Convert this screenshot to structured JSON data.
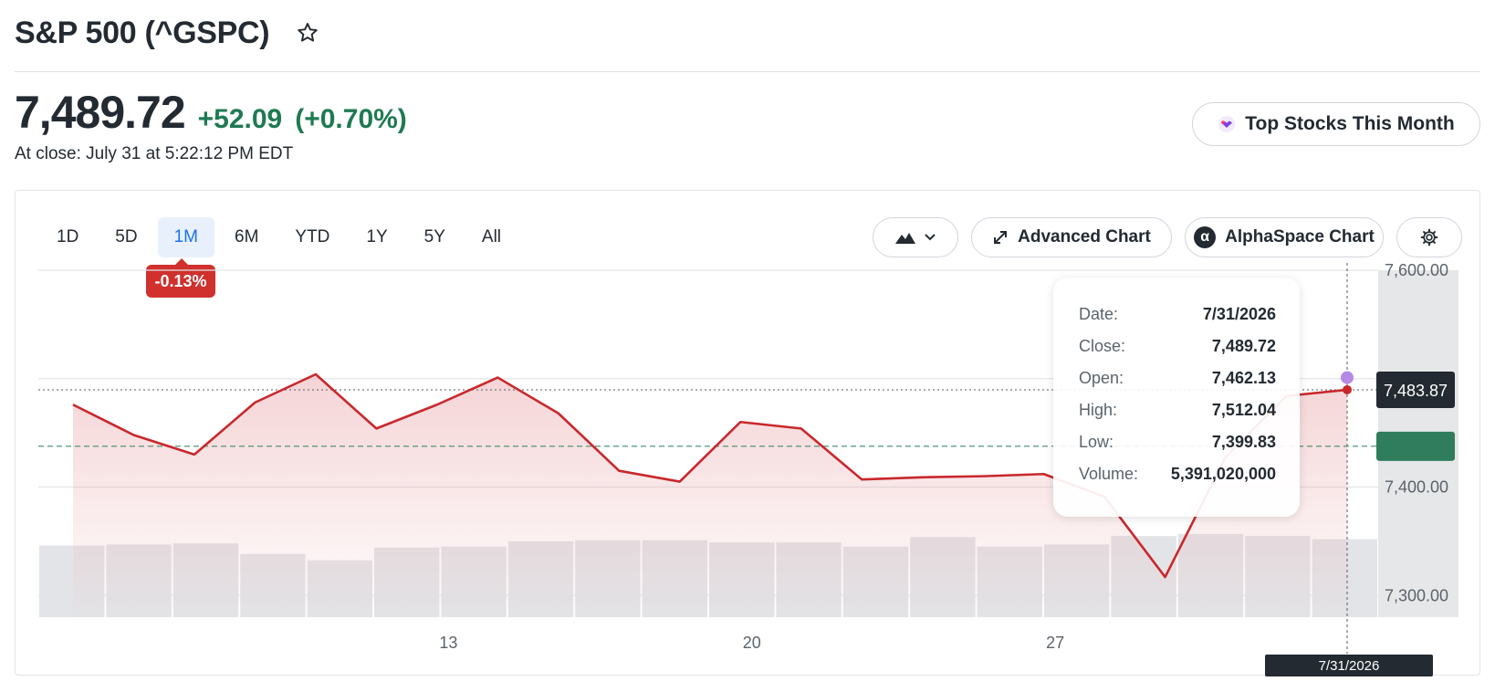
{
  "header": {
    "title": "S&P 500 (^GSPC)",
    "star_icon": "star-outline-icon"
  },
  "quote": {
    "price": "7,489.72",
    "change": "+52.09",
    "change_pct": "(+0.70%)",
    "close_time": "At close: July 31 at 5:22:12 PM EDT",
    "change_color": "#1f7a54"
  },
  "promo": {
    "label": "Top Stocks This Month",
    "icon": "sparkle-icon"
  },
  "ranges": [
    "1D",
    "5D",
    "1M",
    "6M",
    "YTD",
    "1Y",
    "5Y",
    "All"
  ],
  "active_range": "1M",
  "period_change_badge": "-0.13%",
  "toolbar": {
    "chart_type_icon": "mountain-chart-icon",
    "advanced_label": "Advanced Chart",
    "alphaspace_label": "AlphaSpace Chart",
    "alphaspace_glyph": "α",
    "settings_icon": "gear-icon"
  },
  "tooltip": [
    {
      "key": "Date:",
      "value": "7/31/2026"
    },
    {
      "key": "Close:",
      "value": "7,489.72"
    },
    {
      "key": "Open:",
      "value": "7,462.13"
    },
    {
      "key": "High:",
      "value": "7,512.04"
    },
    {
      "key": "Low:",
      "value": "7,399.83"
    },
    {
      "key": "Volume:",
      "value": "5,391,020,000"
    }
  ],
  "crosshair_date": "7/31/2026",
  "current_price_label": "7,483.87",
  "chart_data": {
    "type": "area",
    "x": [
      "7/2",
      "7/3",
      "7/6",
      "7/7",
      "7/8",
      "7/9",
      "7/10",
      "7/13",
      "7/14",
      "7/15",
      "7/16",
      "7/17",
      "7/20",
      "7/21",
      "7/22",
      "7/23",
      "7/24",
      "7/27",
      "7/28",
      "7/29",
      "7/30",
      "7/31"
    ],
    "series": [
      {
        "values": [
          7476,
          7448,
          7430,
          7478,
          7504,
          7454,
          7476,
          7501,
          7468,
          7415,
          7405,
          7460,
          7454,
          7407,
          7409,
          7410,
          7412,
          7391,
          7317,
          7428,
          7484,
          7489.72
        ],
        "color": "#c8282c"
      }
    ],
    "volume": [
      3.4,
      3.45,
      3.5,
      3.0,
      2.7,
      3.3,
      3.35,
      3.6,
      3.65,
      3.65,
      3.55,
      3.55,
      3.35,
      3.8,
      3.35,
      3.45,
      3.85,
      3.95,
      3.85,
      3.7
    ],
    "y_ticks": [
      "7,600.00",
      "7,400.00",
      "7,300.00"
    ],
    "x_ticks": [
      "13",
      "20",
      "27"
    ],
    "ylim": [
      7280,
      7600
    ],
    "prev_close": 7437.63,
    "grid": true
  }
}
